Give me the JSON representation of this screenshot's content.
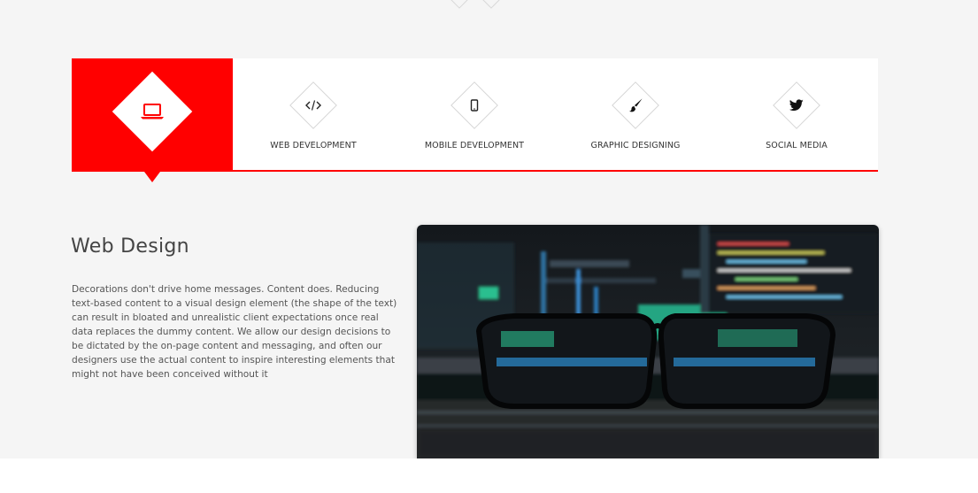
{
  "colors": {
    "accent": "#ff0000",
    "background": "#f5f5f5",
    "panel": "#ffffff",
    "text": "#444444"
  },
  "tabs": {
    "active": {
      "icon": "laptop-icon"
    },
    "items": [
      {
        "label": "WEB DEVELOPMENT",
        "icon": "code-icon"
      },
      {
        "label": "MOBILE DEVELOPMENT",
        "icon": "mobile-phone-icon"
      },
      {
        "label": "GRAPHIC DESIGNING",
        "icon": "paint-brush-icon"
      },
      {
        "label": "SOCIAL MEDIA",
        "icon": "twitter-icon"
      }
    ]
  },
  "content": {
    "title": "Web Design",
    "description": "Decorations don't drive home messages. Content does. Reducing text-based content to a visual design element (the shape of the text) can result in bloated and unrealistic client expectations once real data replaces the dummy content. We allow our design decisions to be dictated by the on-page content and messaging, and often our designers use the actual content to inspire interesting elements that might not have been conceived without it"
  }
}
